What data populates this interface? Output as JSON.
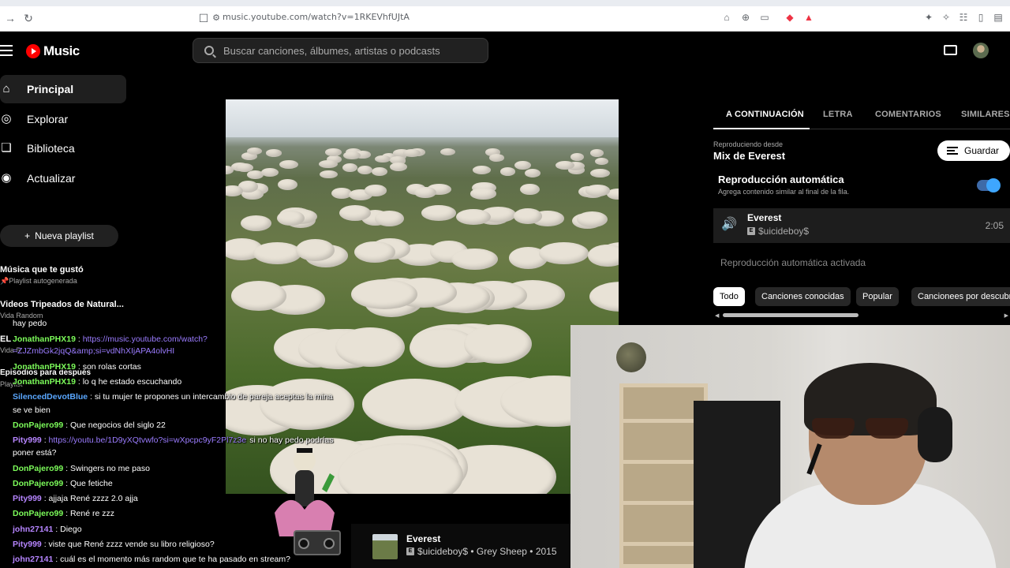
{
  "browser": {
    "url": "music.youtube.com/watch?v=1RKEVhfUJtA"
  },
  "header": {
    "logo_text": "Music",
    "search_placeholder": "Buscar canciones, álbumes, artistas o podcasts"
  },
  "sidebar": {
    "items": [
      {
        "label": "Principal",
        "icon": "home-icon",
        "active": true
      },
      {
        "label": "Explorar",
        "icon": "compass-icon",
        "active": false
      },
      {
        "label": "Biblioteca",
        "icon": "bookmark-icon",
        "active": false
      },
      {
        "label": "Actualizar",
        "icon": "upgrade-icon",
        "active": false
      }
    ],
    "new_playlist_label": "Nueva playlist",
    "playlists": [
      {
        "title": "Música que te gustó",
        "subtitle": "Playlist autogenerada"
      },
      {
        "title": "Videos Tripeados de Natural...",
        "subtitle": "Vida Random"
      },
      {
        "title": "EL",
        "subtitle": "Vida R"
      },
      {
        "title": "Episodios para después",
        "subtitle": "Playlist"
      }
    ]
  },
  "panel": {
    "tabs": [
      "A CONTINUACIÓN",
      "LETRA",
      "COMENTARIOS",
      "SIMILARES"
    ],
    "playing_from_label": "Reproduciendo desde",
    "playing_from_name": "Mix de Everest",
    "save_label": "Guardar",
    "autoplay_title": "Reproducción automática",
    "autoplay_subtitle": "Agrega contenido similar al final de la fila.",
    "autoplay_enabled": true,
    "queue": [
      {
        "title": "Everest",
        "artist": "$uicideboy$",
        "duration": "2:05",
        "explicit": true
      }
    ],
    "autoplay_on_label": "Reproducción automática activada",
    "chips": [
      "Todo",
      "Canciones conocidas",
      "Popular",
      "Cancionees por descubrir"
    ]
  },
  "now_playing": {
    "title": "Everest",
    "subtitle": "$uicideboy$ • Grey Sheep • 2015",
    "explicit": true
  },
  "chat": [
    {
      "user": "",
      "text": "hay pedo",
      "user_color": "#ffffff"
    },
    {
      "user": "JonathanPHX19",
      "text": "https://music.youtube.com/watch?",
      "link": true,
      "user_color": "#7cfc5a"
    },
    {
      "user": "",
      "text": "=ZJZmbGk2jqQ&amp;si=vdNhXIjAPA4olvHI",
      "link": true,
      "user_color": "#7cfc5a"
    },
    {
      "user": "JonathanPHX19",
      "text": "son rolas cortas",
      "user_color": "#7cfc5a"
    },
    {
      "user": "JonathanPHX19",
      "text": "lo q he estado escuchando",
      "user_color": "#7cfc5a"
    },
    {
      "user": "SilencedDevotBlue",
      "text": "si tu mujer te propones un intercambio de pareja aceptas la mina",
      "user_color": "#5aa7ff"
    },
    {
      "user": "",
      "text": "se ve bien",
      "user_color": "#ffffff"
    },
    {
      "user": "DonPajero99",
      "text": "Que negocios del siglo 22",
      "user_color": "#7cfc5a"
    },
    {
      "user": "Pity999",
      "text": "https://youtu.be/1D9yXQtvwfo?si=wXpcpc9yF2Pl7z3e",
      "link": true,
      "extra": "si no hay pedo podrías",
      "user_color": "#b685ff"
    },
    {
      "user": "",
      "text": "poner está?",
      "user_color": "#ffffff"
    },
    {
      "user": "DonPajero99",
      "text": "Swingers no me paso",
      "user_color": "#7cfc5a"
    },
    {
      "user": "DonPajero99",
      "text": "Que fetiche",
      "user_color": "#7cfc5a"
    },
    {
      "user": "Pity999",
      "text": "ajjaja René zzzz 2.0 ajja",
      "user_color": "#b685ff"
    },
    {
      "user": "DonPajero99",
      "text": "René re zzz",
      "user_color": "#7cfc5a"
    },
    {
      "user": "john27141",
      "text": "Diego",
      "user_color": "#b685ff"
    },
    {
      "user": "Pity999",
      "text": "viste que René zzzz vende su libro religioso?",
      "user_color": "#b685ff"
    },
    {
      "user": "john27141",
      "text": "cuál es el momento más random que te ha pasado en stream?",
      "user_color": "#b685ff"
    }
  ]
}
